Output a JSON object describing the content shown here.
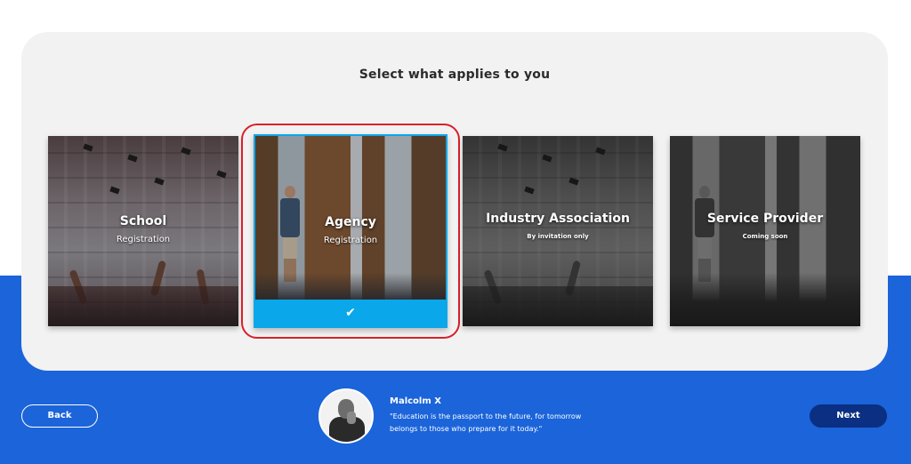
{
  "page": {
    "title": "Select what applies to you"
  },
  "cards": [
    {
      "id": "school",
      "title": "School",
      "subtitle": "Registration",
      "selected": false
    },
    {
      "id": "agency",
      "title": "Agency",
      "subtitle": "Registration",
      "selected": true
    },
    {
      "id": "industry",
      "title": "Industry Association",
      "subtitle": "By invitation only",
      "selected": false
    },
    {
      "id": "service",
      "title": "Service Provider",
      "subtitle": "Coming soon",
      "selected": false
    }
  ],
  "selection": {
    "check_glyph": "✔",
    "check_icon": "checkmark-icon"
  },
  "footer": {
    "back_label": "Back",
    "next_label": "Next",
    "quote_author": "Malcolm X",
    "quote_text": "\"Education is the passport to the future, for tomorrow belongs to those who prepare for it today.\""
  },
  "colors": {
    "brand_blue": "#1b64da",
    "next_button": "#0b2f82",
    "selected_accent": "#0aa7ea",
    "highlight_frame": "#d9202a",
    "panel": "#f2f2f2"
  }
}
